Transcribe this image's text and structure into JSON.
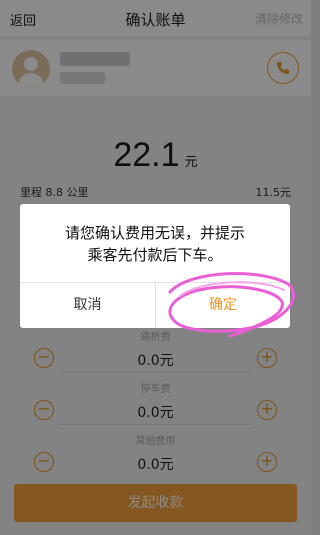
{
  "header": {
    "back_label": "返回",
    "title": "确认账单",
    "clear_label": "清除修改"
  },
  "fare": {
    "amount": "22.1",
    "unit": "元"
  },
  "trip": {
    "mileage_label": "里程 8.8 公里",
    "mileage_value": "11.5元"
  },
  "fees": [
    {
      "label": "路桥费",
      "value": "0.0元"
    },
    {
      "label": "停车费",
      "value": "0.0元"
    },
    {
      "label": "其他费用",
      "value": "0.0元"
    }
  ],
  "submit_label": "发起收款",
  "dialog": {
    "message_line1": "请您确认费用无误，并提示",
    "message_line2": "乘客先付款后下车。",
    "cancel_label": "取消",
    "confirm_label": "确定"
  },
  "colors": {
    "accent": "#f3a23a",
    "highlight": "#e85fd6"
  },
  "icons": {
    "phone": "phone-icon",
    "avatar": "avatar-icon"
  }
}
